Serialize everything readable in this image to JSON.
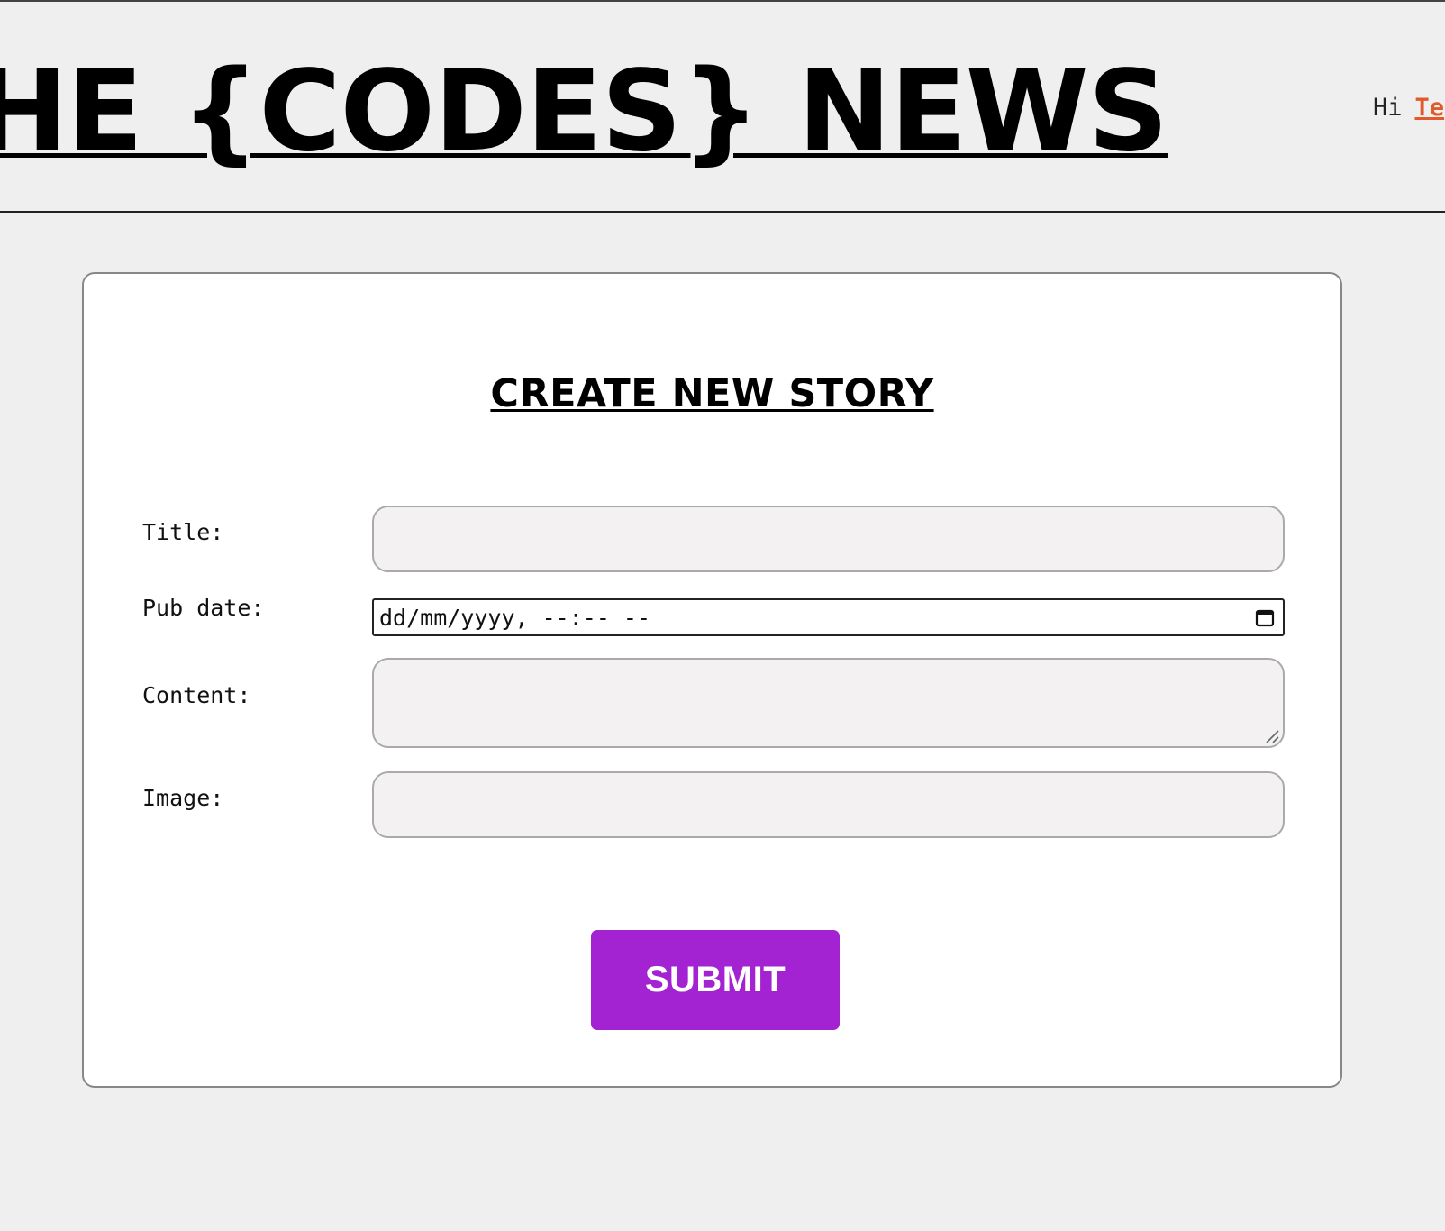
{
  "header": {
    "site_title": "THE {CODES} NEWS",
    "greeting": "Hi",
    "user_link": "Te"
  },
  "form": {
    "heading": "CREATE NEW STORY",
    "fields": {
      "title": {
        "label": "Title:",
        "value": ""
      },
      "pub_date": {
        "label": "Pub date:",
        "value": "dd/mm/yyyy, --:-- --",
        "icon": "calendar-icon"
      },
      "content": {
        "label": "Content:",
        "value": ""
      },
      "image": {
        "label": "Image:",
        "value": ""
      }
    },
    "submit_label": "SUBMIT"
  },
  "colors": {
    "background": "#efefef",
    "card": "#ffffff",
    "accent": "#a323d2",
    "user_link": "#e05a2b",
    "input_bg": "#f3f1f2"
  }
}
